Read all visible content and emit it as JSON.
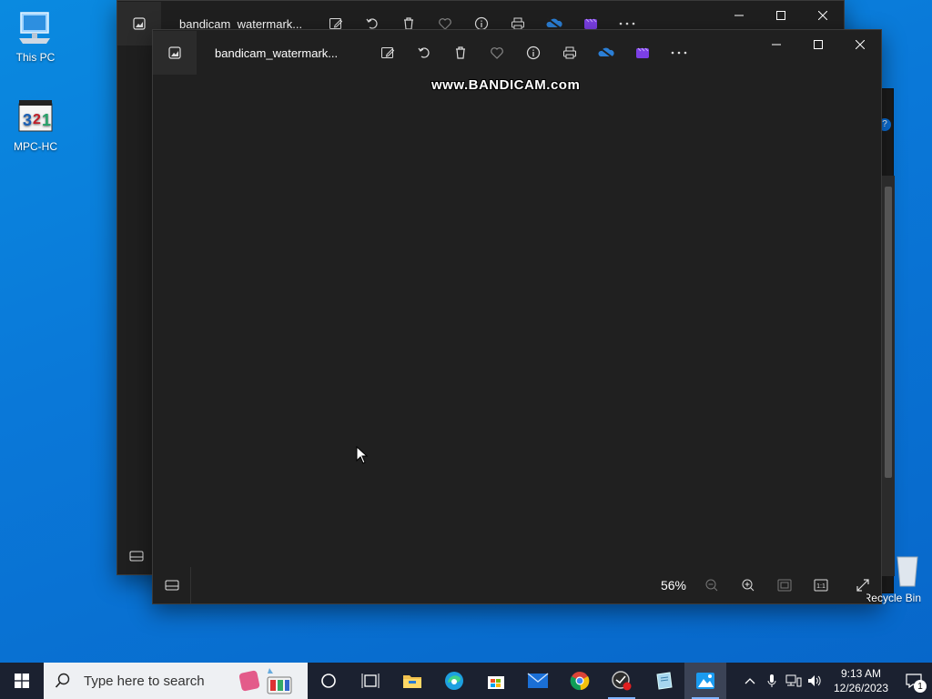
{
  "desktop": {
    "icons": [
      {
        "label": "This PC"
      },
      {
        "label": "MPC-HC"
      },
      {
        "label": "Recycle Bin"
      }
    ]
  },
  "back_window": {
    "title": "bandicam_watermark...",
    "toolbar": [
      "edit-icon",
      "rotate-icon",
      "delete-icon",
      "favorite-icon",
      "info-icon",
      "print-icon",
      "onedrive-icon",
      "clipchamp-icon",
      "more-icon"
    ]
  },
  "front_window": {
    "title": "bandicam_watermark...",
    "watermark": "www.BANDICAM.com",
    "zoom": "56%",
    "toolbar": [
      "edit-icon",
      "rotate-icon",
      "delete-icon",
      "favorite-icon",
      "info-icon",
      "print-icon",
      "onedrive-icon",
      "clipchamp-icon",
      "more-icon"
    ]
  },
  "taskbar": {
    "search_placeholder": "Type here to search",
    "time": "9:13 AM",
    "date": "12/26/2023",
    "notification_count": "1"
  }
}
